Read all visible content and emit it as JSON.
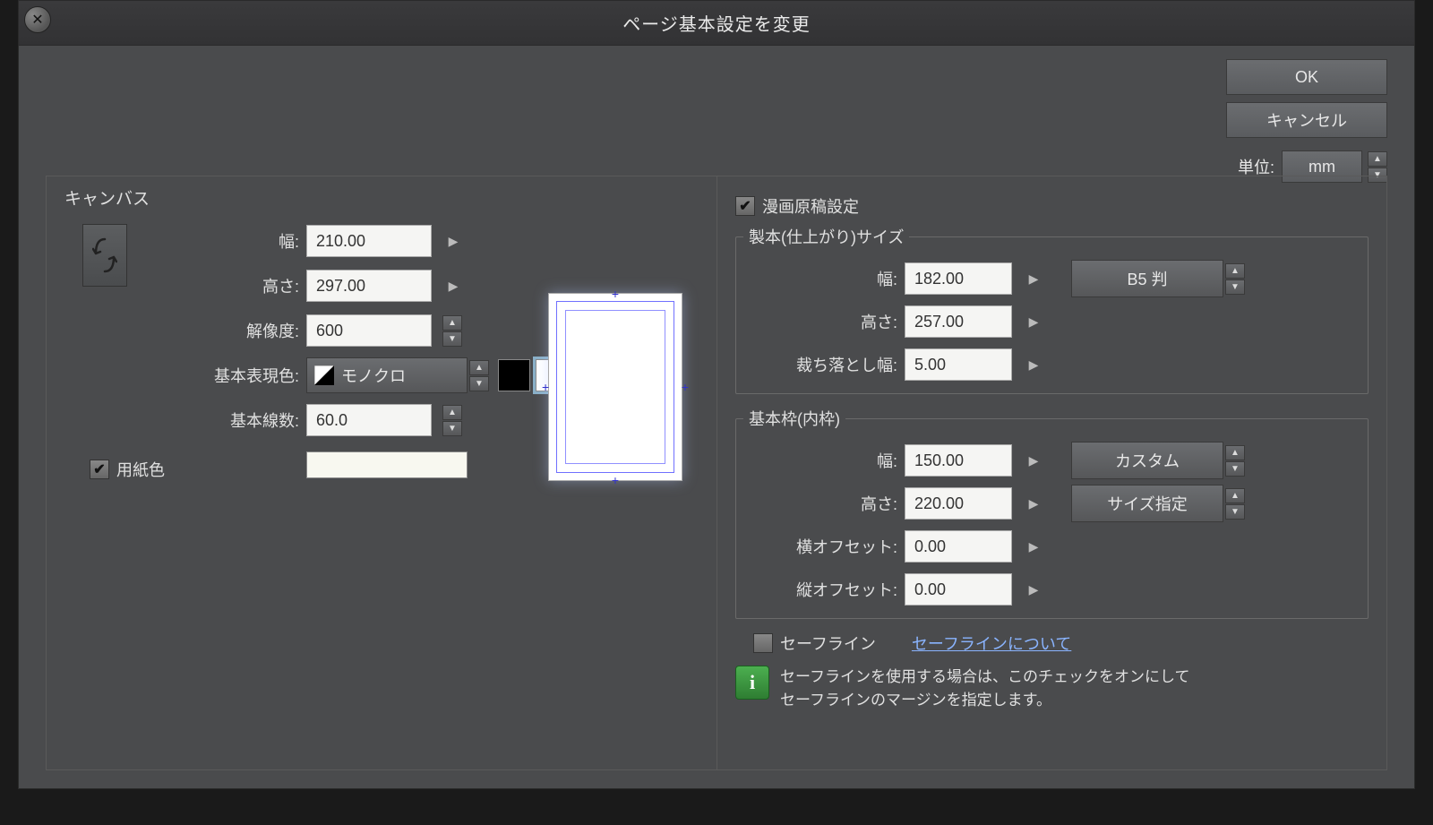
{
  "title": "ページ基本設定を変更",
  "buttons": {
    "ok": "OK",
    "cancel": "キャンセル"
  },
  "unit": {
    "label": "単位:",
    "value": "mm"
  },
  "canvas": {
    "title": "キャンバス",
    "width_label": "幅:",
    "width": "210.00",
    "height_label": "高さ:",
    "height": "297.00",
    "resolution_label": "解像度:",
    "resolution": "600",
    "basic_color_label": "基本表現色:",
    "basic_color": "モノクロ",
    "screen_freq_label": "基本線数:",
    "screen_freq": "60.0",
    "paper_color_label": "用紙色"
  },
  "manga": {
    "enable_label": "漫画原稿設定",
    "binding": {
      "title": "製本(仕上がり)サイズ",
      "width_label": "幅:",
      "width": "182.00",
      "height_label": "高さ:",
      "height": "257.00",
      "bleed_label": "裁ち落とし幅:",
      "bleed": "5.00",
      "preset": "B5 判"
    },
    "frame": {
      "title": "基本枠(内枠)",
      "width_label": "幅:",
      "width": "150.00",
      "height_label": "高さ:",
      "height": "220.00",
      "xoffset_label": "横オフセット:",
      "xoffset": "0.00",
      "yoffset_label": "縦オフセット:",
      "yoffset": "0.00",
      "preset": "カスタム",
      "mode": "サイズ指定"
    },
    "safeline": {
      "label": "セーフライン",
      "link": "セーフラインについて",
      "info1": "セーフラインを使用する場合は、このチェックをオンにして",
      "info2": "セーフラインのマージンを指定します。"
    }
  }
}
